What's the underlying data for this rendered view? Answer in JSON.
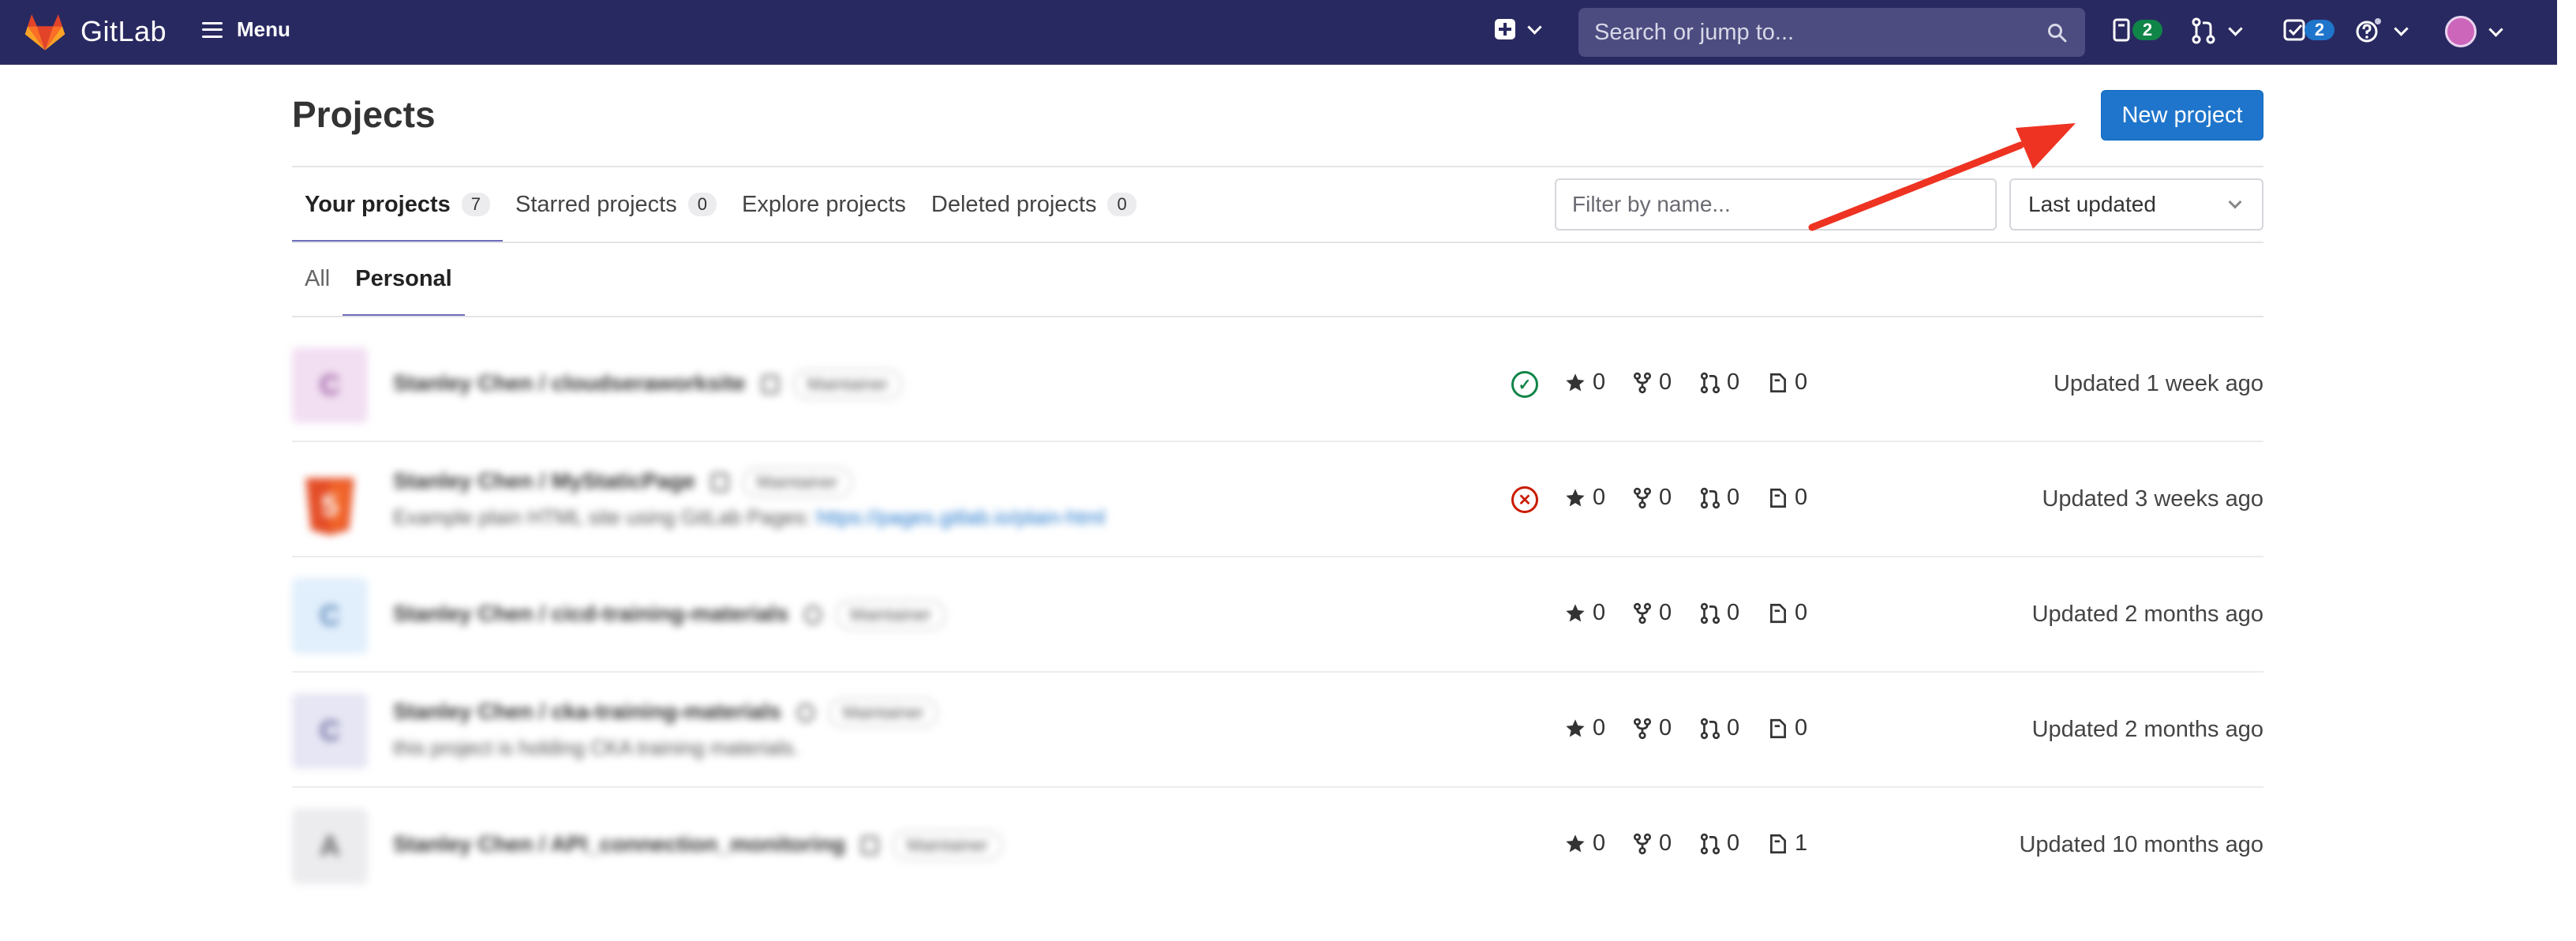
{
  "navbar": {
    "logo_text": "GitLab",
    "menu_label": "Menu",
    "search_placeholder": "Search or jump to...",
    "issues_count": "2",
    "todos_count": "2",
    "colors": {
      "bg": "#292961",
      "issues_badge": "#108548",
      "todos_badge": "#1f75cb"
    }
  },
  "page": {
    "title": "Projects",
    "new_project_label": "New project"
  },
  "tabs": [
    {
      "label": "Your projects",
      "count": "7",
      "active": true
    },
    {
      "label": "Starred projects",
      "count": "0"
    },
    {
      "label": "Explore projects"
    },
    {
      "label": "Deleted projects",
      "count": "0"
    }
  ],
  "filter": {
    "placeholder": "Filter by name...",
    "sort_selected": "Last updated"
  },
  "subtabs": [
    {
      "label": "All"
    },
    {
      "label": "Personal",
      "active": true
    }
  ],
  "projects": [
    {
      "avatar_letter": "C",
      "name": "Stanley Chen / cloudseraworksite",
      "role": "Maintainer",
      "description": "",
      "status": "passed",
      "stars": "0",
      "forks": "0",
      "merge_requests": "0",
      "issues": "0",
      "updated": "Updated 1 week ago"
    },
    {
      "avatar_letter": "5",
      "name": "Stanley Chen / MyStaticPage",
      "role": "Maintainer",
      "description": "Example plain HTML site using GitLab Pages:",
      "description_link": "https://pages.gitlab.io/plain-html",
      "status": "failed",
      "stars": "0",
      "forks": "0",
      "merge_requests": "0",
      "issues": "0",
      "updated": "Updated 3 weeks ago"
    },
    {
      "avatar_letter": "C",
      "name": "Stanley Chen / cicd-training-materials",
      "role": "Maintainer",
      "description": "",
      "status": "",
      "stars": "0",
      "forks": "0",
      "merge_requests": "0",
      "issues": "0",
      "updated": "Updated 2 months ago"
    },
    {
      "avatar_letter": "C",
      "name": "Stanley Chen / cka-training-materials",
      "role": "Maintainer",
      "description": "this project is holding CKA training materials.",
      "status": "",
      "stars": "0",
      "forks": "0",
      "merge_requests": "0",
      "issues": "0",
      "updated": "Updated 2 months ago"
    },
    {
      "avatar_letter": "A",
      "name": "Stanley Chen / API_connection_monitoring",
      "role": "Maintainer",
      "description": "",
      "status": "",
      "stars": "0",
      "forks": "0",
      "merge_requests": "0",
      "issues": "1",
      "updated": "Updated 10 months ago"
    }
  ],
  "annotation": {
    "arrow_color": "#ee3322"
  }
}
